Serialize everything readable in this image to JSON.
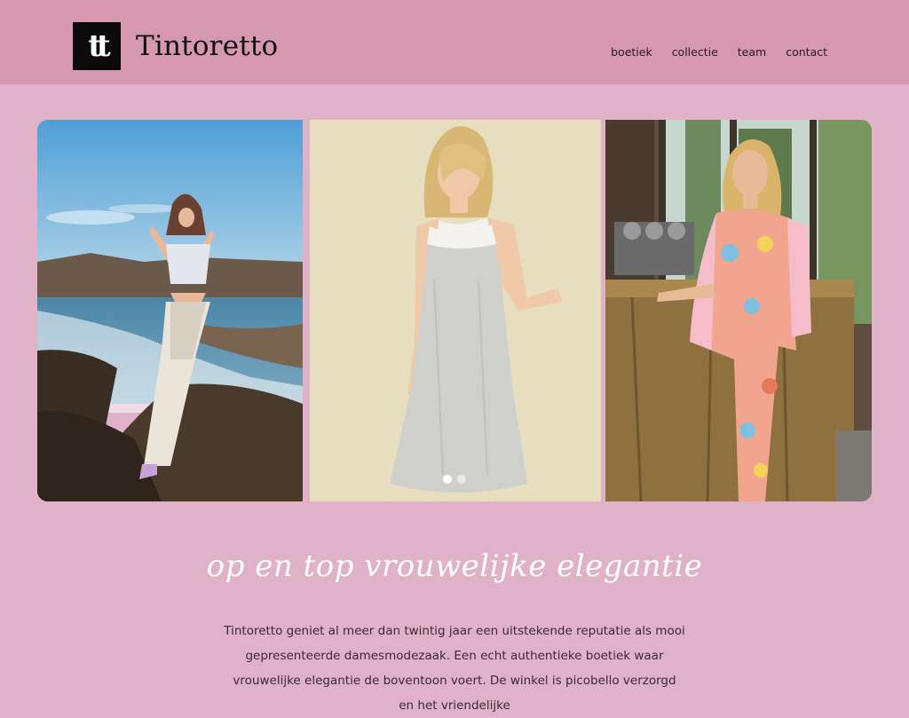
{
  "brand": {
    "logo_mark": "tt",
    "name": "Tintoretto"
  },
  "nav": {
    "items": [
      "boetiek",
      "collectie",
      "team",
      "contact"
    ]
  },
  "slider": {
    "active_index": 0,
    "dot_count": 2
  },
  "tagline": "op en top vrouwelijke elegantie",
  "intro": "Tintoretto geniet al meer dan twintig jaar een uitstekende reputatie als mooi gepresenteerde damesmodezaak. Een echt authentieke boetiek waar vrouwelijke elegantie de boventoon voert. De winkel is picobello verzorgd en het vriendelijke",
  "colors": {
    "header": "#d598ae",
    "page": "#dfb2c7",
    "logo_bg": "#0d0a0b"
  }
}
